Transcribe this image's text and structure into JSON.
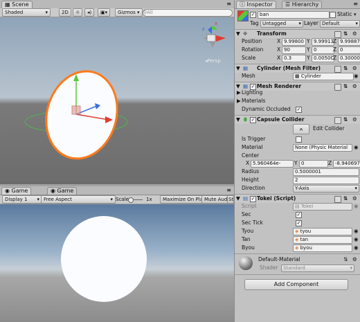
{
  "scene": {
    "tab": "Scene",
    "shading": "Shaded",
    "mode2d": "2D",
    "gizmos": "Gizmos",
    "search_all": "All",
    "persp": "Persp"
  },
  "game": {
    "tab_active": "Game",
    "tab_other": "Game",
    "display": "Display 1",
    "aspect": "Free Aspect",
    "scale_label": "Scale",
    "scale_value": "1x",
    "maximize": "Maximize On Play",
    "mute": "Mute Audio",
    "stats": "St"
  },
  "inspector": {
    "tab": "Inspector",
    "hierarchy_tab": "Hierarchy",
    "object_name": "ban",
    "static_label": "Static",
    "tag_label": "Tag",
    "tag_value": "Untagged",
    "layer_label": "Layer",
    "layer_value": "Default",
    "transform": {
      "title": "Transform",
      "position_label": "Position",
      "rotation_label": "Rotation",
      "scale_label": "Scale",
      "x": "X",
      "y": "Y",
      "z": "Z",
      "position": [
        "9.99800",
        "9.99913",
        "9.99887"
      ],
      "rotation": [
        "90",
        "0",
        "0"
      ],
      "scale": [
        "0.3",
        "0.0050C",
        "0.30000"
      ]
    },
    "mesh_filter": {
      "title": "Cylinder (Mesh Filter)",
      "mesh_label": "Mesh",
      "mesh_value": "Cylinder"
    },
    "mesh_renderer": {
      "title": "Mesh Renderer",
      "lighting": "Lighting",
      "materials": "Materials",
      "dynamic_occluded": "Dynamic Occluded"
    },
    "capsule": {
      "title": "Capsule Collider",
      "edit_collider": "Edit Collider",
      "is_trigger": "Is Trigger",
      "material_label": "Material",
      "material_value": "None (Physic Material",
      "center_label": "Center",
      "center": [
        "5.960464e-",
        "0",
        "-8.9406976"
      ],
      "radius_label": "Radius",
      "radius": "0.5000001",
      "height_label": "Height",
      "height": "2",
      "direction_label": "Direction",
      "direction": "Y-Axis"
    },
    "tokei": {
      "title": "Tokei (Script)",
      "script_label": "Script",
      "script_value": "Tokei",
      "sec_label": "Sec",
      "sec_tick_label": "Sec Tick",
      "tyou_label": "Tyou",
      "tyou_value": "tyou",
      "tan_label": "Tan",
      "tan_value": "tan",
      "byou_label": "Byou",
      "byou_value": "byou"
    },
    "material": {
      "name": "Default-Material",
      "shader_label": "Shader",
      "shader_value": "Standard"
    },
    "add_component": "Add Component"
  }
}
